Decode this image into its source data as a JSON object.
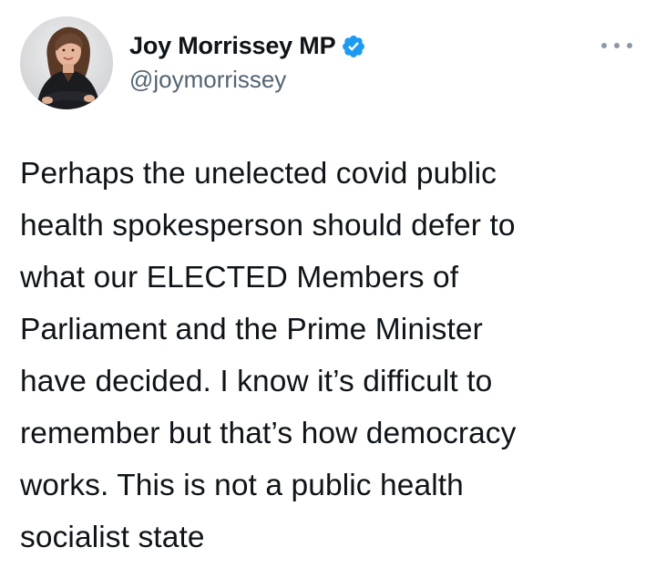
{
  "author": {
    "display_name": "Joy Morrissey MP",
    "handle": "@joymorrissey",
    "verified_icon": "verified-badge-icon",
    "avatar_icon": "profile-photo"
  },
  "menu": {
    "icon": "more-options-icon"
  },
  "tweet": {
    "text": "Perhaps the unelected covid public\nhealth spokesperson should defer to\nwhat our ELECTED Members of\nParliament and the Prime Minister\nhave decided. I know it’s difficult to\nremember but that’s how democracy\nworks. This is not a public health\nsocialist state"
  },
  "colors": {
    "verified_blue": "#1d9bf0",
    "handle_gray": "#536471",
    "text": "#0f1419"
  }
}
